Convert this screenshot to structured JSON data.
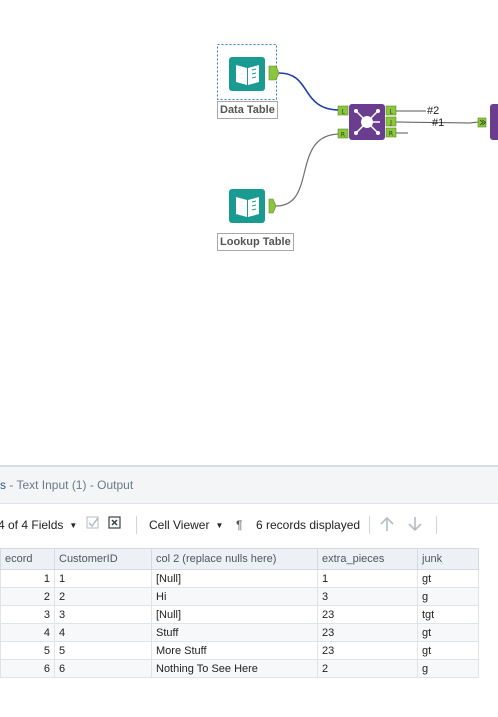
{
  "canvas": {
    "tools": [
      {
        "id": "data-table",
        "label": "Data Table"
      },
      {
        "id": "lookup-table",
        "label": "Lookup Table"
      }
    ],
    "join_tool": {
      "input_anchors": [
        "L",
        "R"
      ],
      "output_anchors": [
        "L",
        "J",
        "R"
      ]
    },
    "connection_labels": [
      "#2",
      "#1"
    ]
  },
  "results": {
    "title_prefix": "s",
    "title_suffix": " - Text Input (1) - Output",
    "fields_label": "4 of 4 Fields",
    "cell_viewer_label": "Cell Viewer",
    "records_label": "6 records displayed",
    "columns": [
      "ecord",
      "CustomerID",
      "col 2 (replace nulls here)",
      "extra_pieces",
      "junk"
    ],
    "rows": [
      [
        "1",
        "1",
        "[Null]",
        "1",
        "gt"
      ],
      [
        "2",
        "2",
        "Hi",
        "3",
        "g"
      ],
      [
        "3",
        "3",
        "[Null]",
        "23",
        "tgt"
      ],
      [
        "4",
        "4",
        "Stuff",
        "23",
        "gt"
      ],
      [
        "5",
        "5",
        "More Stuff",
        "23",
        "gt"
      ],
      [
        "6",
        "6",
        "Nothing To See Here",
        "2",
        "g"
      ]
    ],
    "null_value": "[Null]"
  },
  "colors": {
    "tool_teal": "#1a9b92",
    "join_purple": "#6a3d8f",
    "anchor_green": "#8cc63f",
    "connection_blue": "#1b3fa8",
    "header_bg": "#edf1f5"
  },
  "icons": [
    "book-icon",
    "join-icon",
    "browse-icon",
    "check-icon",
    "clear-icon",
    "pilcrow-icon",
    "arrow-up-icon",
    "arrow-down-icon"
  ]
}
